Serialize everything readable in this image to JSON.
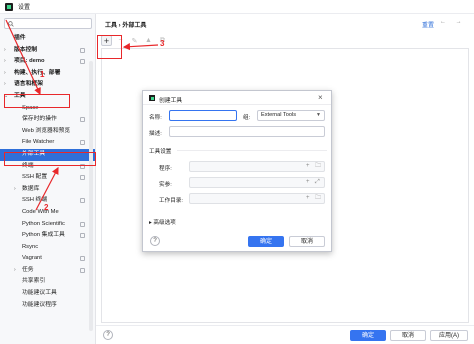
{
  "window": {
    "title": "设置"
  },
  "sidebar": {
    "search_placeholder": "Q▾",
    "items": [
      {
        "label": "插件",
        "level": 0,
        "bold": true,
        "arrow": "",
        "marked": false
      },
      {
        "label": "版本控制",
        "level": 0,
        "bold": true,
        "arrow": "›",
        "marked": true
      },
      {
        "label": "项目: demo",
        "level": 0,
        "bold": true,
        "arrow": "›",
        "marked": true
      },
      {
        "label": "构建、执行、部署",
        "level": 0,
        "bold": true,
        "arrow": "›",
        "marked": false
      },
      {
        "label": "语言和框架",
        "level": 0,
        "bold": true,
        "arrow": "›",
        "marked": false
      },
      {
        "label": "工具",
        "level": 0,
        "bold": true,
        "arrow": "⌄",
        "marked": false
      },
      {
        "label": "Space",
        "level": 1,
        "bold": false,
        "arrow": "",
        "marked": false
      },
      {
        "label": "保存时的操作",
        "level": 1,
        "bold": false,
        "arrow": "",
        "marked": true
      },
      {
        "label": "Web 浏览器和预览",
        "level": 1,
        "bold": false,
        "arrow": "",
        "marked": false
      },
      {
        "label": "File Watcher",
        "level": 1,
        "bold": false,
        "arrow": "",
        "marked": true
      },
      {
        "label": "外部工具",
        "level": 1,
        "bold": false,
        "arrow": "",
        "marked": false,
        "selected": true
      },
      {
        "label": "终端",
        "level": 1,
        "bold": false,
        "arrow": "",
        "marked": true
      },
      {
        "label": "SSH 配置",
        "level": 1,
        "bold": false,
        "arrow": "",
        "marked": true
      },
      {
        "label": "数据库",
        "level": 1,
        "bold": false,
        "arrow": "›",
        "marked": false
      },
      {
        "label": "SSH 终端",
        "level": 1,
        "bold": false,
        "arrow": "",
        "marked": true
      },
      {
        "label": "Code With Me",
        "level": 1,
        "bold": false,
        "arrow": "",
        "marked": false
      },
      {
        "label": "Python Scientific",
        "level": 1,
        "bold": false,
        "arrow": "",
        "marked": true
      },
      {
        "label": "Python 集成工具",
        "level": 1,
        "bold": false,
        "arrow": "",
        "marked": true
      },
      {
        "label": "Rsync",
        "level": 1,
        "bold": false,
        "arrow": "",
        "marked": false
      },
      {
        "label": "Vagrant",
        "level": 1,
        "bold": false,
        "arrow": "",
        "marked": true
      },
      {
        "label": "任务",
        "level": 1,
        "bold": false,
        "arrow": "›",
        "marked": true
      },
      {
        "label": "共享索引",
        "level": 1,
        "bold": false,
        "arrow": "",
        "marked": false
      },
      {
        "label": "功能建议工具",
        "level": 1,
        "bold": false,
        "arrow": "",
        "marked": false
      },
      {
        "label": "功能建议程序",
        "level": 1,
        "bold": false,
        "arrow": "",
        "marked": false
      }
    ]
  },
  "content": {
    "breadcrumb": "工具  ›  外部工具",
    "reset": "重置",
    "nav": "← →",
    "toolbar": {
      "add": "+",
      "remove": "−",
      "edit": "✎",
      "up": "▲",
      "copy": "⧉"
    }
  },
  "footer": {
    "help": "?",
    "ok": "确定",
    "cancel": "取消",
    "apply": "应用(A)"
  },
  "dialog": {
    "title": "创建工具",
    "name_label": "名称:",
    "name_value": "",
    "group_label": "组:",
    "group_value": "External Tools",
    "desc_label": "描述:",
    "desc_value": "",
    "section": "工具设置",
    "program_label": "程序:",
    "args_label": "实参:",
    "workdir_label": "工作目录:",
    "advanced": "高级选项",
    "help": "?",
    "ok": "确定",
    "cancel": "取消"
  },
  "annotations": {
    "n1": "1",
    "n2": "2",
    "n3": "3",
    "color": "#e8282b"
  }
}
